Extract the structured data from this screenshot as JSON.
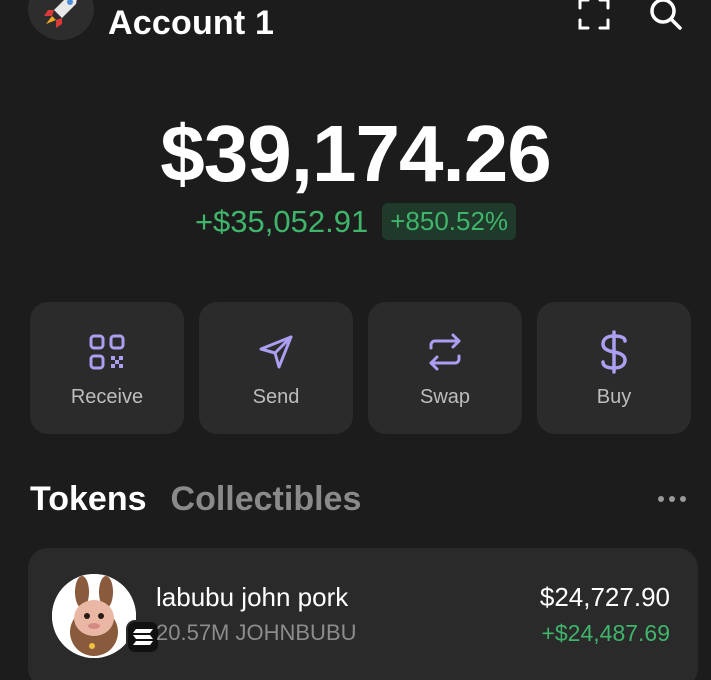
{
  "header": {
    "account_name": "Account 1",
    "avatar_icon": "rocket-icon",
    "scan_icon": "scan-icon",
    "search_icon": "search-icon"
  },
  "balance": {
    "total": "$39,174.26",
    "change_amount": "+$35,052.91",
    "change_percent": "+850.52%"
  },
  "actions": [
    {
      "label": "Receive",
      "icon": "qr-code-icon"
    },
    {
      "label": "Send",
      "icon": "send-icon"
    },
    {
      "label": "Swap",
      "icon": "swap-icon"
    },
    {
      "label": "Buy",
      "icon": "dollar-icon"
    }
  ],
  "tabs": [
    {
      "label": "Tokens",
      "active": true
    },
    {
      "label": "Collectibles",
      "active": false
    }
  ],
  "tokens": [
    {
      "name": "labubu john pork",
      "amount": "20.57M JOHNBUBU",
      "value": "$24,727.90",
      "change": "+$24,487.69",
      "chain_icon": "solana-icon"
    }
  ],
  "colors": {
    "background": "#1c1c1c",
    "card": "#2b2b2b",
    "positive": "#3fb56b",
    "accent": "#ab9ff2"
  }
}
